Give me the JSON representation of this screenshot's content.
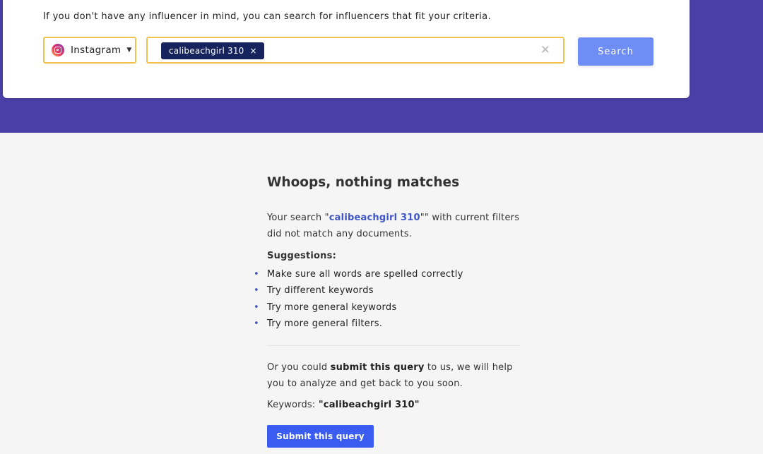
{
  "search_panel": {
    "intro": "If you don't have any influencer in mind, you can search for influencers that fit your criteria.",
    "platform": {
      "selected": "Instagram",
      "icon": "instagram-icon"
    },
    "keyword_chip": {
      "label": "calibeachgirl 310",
      "remove_symbol": "×"
    },
    "clear_symbol": "✕",
    "search_button": "Search"
  },
  "no_results": {
    "heading": "Whoops, nothing matches",
    "message_prefix": "Your search \"",
    "query": "calibeachgirl 310",
    "message_suffix": "\"\" with current filters did not match any documents.",
    "suggestions_title": "Suggestions:",
    "suggestions": [
      "Make sure all words are spelled correctly",
      "Try different keywords",
      "Try more general keywords",
      "Try more general filters."
    ],
    "submit_prefix": "Or you could ",
    "submit_strong": "submit this query",
    "submit_suffix": " to us, we will help you to analyze and get back to you soon.",
    "keywords_label": "Keywords: ",
    "keywords_value": "\"calibeachgirl 310\"",
    "submit_button": "Submit this query"
  },
  "colors": {
    "band": "#4a3fa6",
    "accent_border": "#f2c14e",
    "chip_bg": "#16245e",
    "search_button": "#6f8ef5",
    "submit_button": "#3b5cf0",
    "link": "#4055c8"
  }
}
